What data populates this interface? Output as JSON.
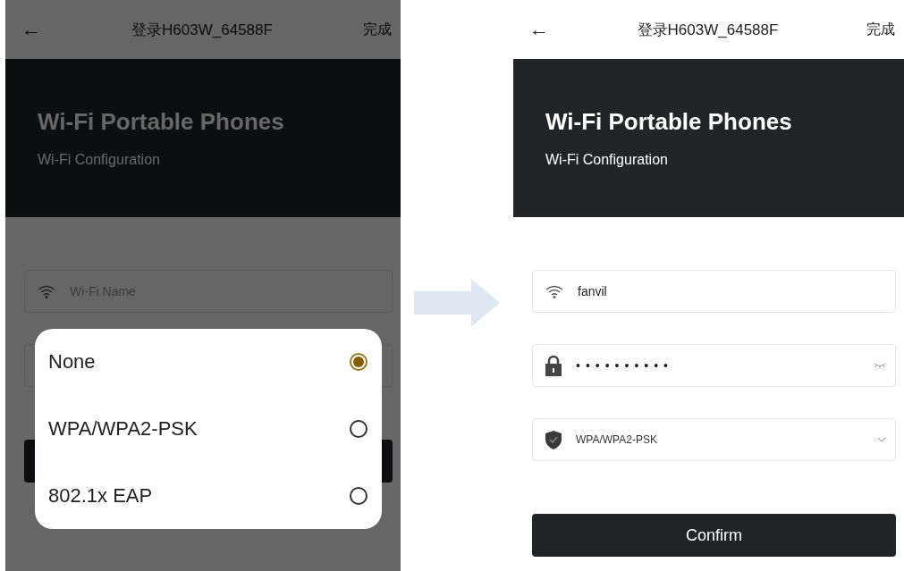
{
  "left_screen": {
    "header": {
      "back": "←",
      "title": "登录H603W_64588F",
      "done": "完成"
    },
    "banner": {
      "title": "Wi-Fi Portable Phones",
      "subtitle": "Wi-Fi Configuration"
    },
    "fields": [
      {
        "kind": "wifi",
        "placeholder": "Wi-Fi Name"
      },
      {
        "kind": "security"
      }
    ],
    "dialog": {
      "options": [
        {
          "label": "None",
          "selected": true
        },
        {
          "label": "WPA/WPA2-PSK",
          "selected": false
        },
        {
          "label": "802.1x EAP",
          "selected": false
        }
      ]
    }
  },
  "right_screen": {
    "header": {
      "back": "←",
      "title": "登录H603W_64588F",
      "done": "完成"
    },
    "banner": {
      "title": "Wi-Fi Portable Phones",
      "subtitle": "Wi-Fi Configuration"
    },
    "fields": [
      {
        "kind": "wifi",
        "value": "fanvil"
      },
      {
        "kind": "password",
        "value": "••••••••••"
      },
      {
        "kind": "security",
        "value": "WPA/WPA2-PSK"
      }
    ],
    "confirm_button": {
      "label": "Confirm"
    }
  }
}
